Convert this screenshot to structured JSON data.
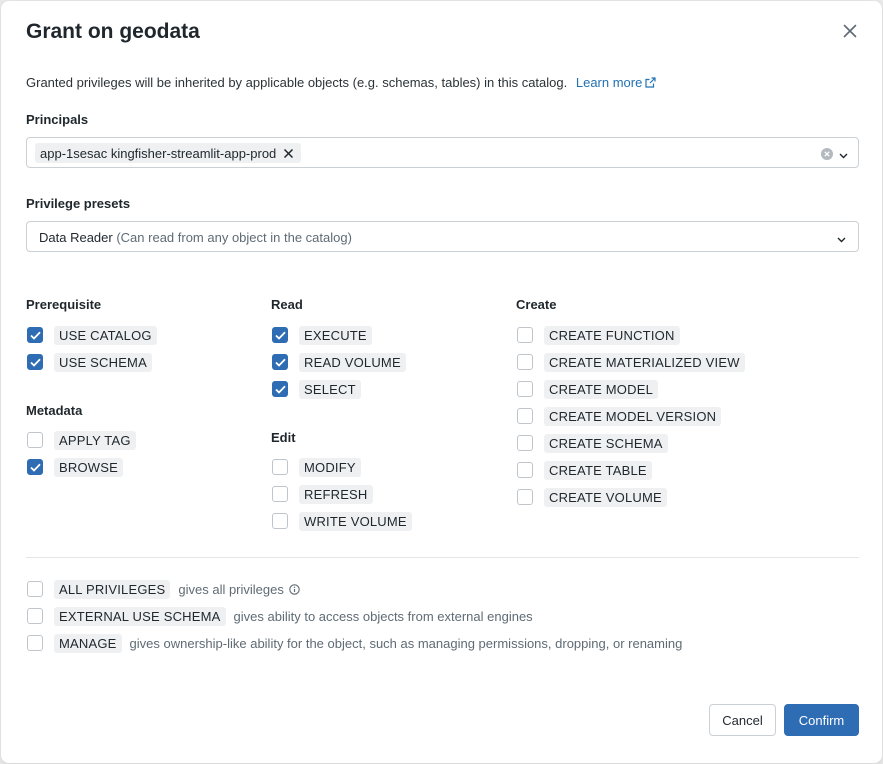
{
  "dialog": {
    "title": "Grant on geodata",
    "description": "Granted privileges will be inherited by applicable objects (e.g. schemas, tables) in this catalog.",
    "learn_more": "Learn more"
  },
  "principals": {
    "label": "Principals",
    "selected": "app-1sesac kingfisher-streamlit-app-prod"
  },
  "presets": {
    "label": "Privilege presets",
    "value": "Data Reader",
    "hint": "(Can read from any object in the catalog)"
  },
  "groups": {
    "prerequisite": {
      "heading": "Prerequisite",
      "items": [
        {
          "label": "USE CATALOG",
          "checked": true
        },
        {
          "label": "USE SCHEMA",
          "checked": true
        }
      ]
    },
    "metadata": {
      "heading": "Metadata",
      "items": [
        {
          "label": "APPLY TAG",
          "checked": false
        },
        {
          "label": "BROWSE",
          "checked": true
        }
      ]
    },
    "read": {
      "heading": "Read",
      "items": [
        {
          "label": "EXECUTE",
          "checked": true
        },
        {
          "label": "READ VOLUME",
          "checked": true
        },
        {
          "label": "SELECT",
          "checked": true
        }
      ]
    },
    "edit": {
      "heading": "Edit",
      "items": [
        {
          "label": "MODIFY",
          "checked": false
        },
        {
          "label": "REFRESH",
          "checked": false
        },
        {
          "label": "WRITE VOLUME",
          "checked": false
        }
      ]
    },
    "create": {
      "heading": "Create",
      "items": [
        {
          "label": "CREATE FUNCTION",
          "checked": false
        },
        {
          "label": "CREATE MATERIALIZED VIEW",
          "checked": false
        },
        {
          "label": "CREATE MODEL",
          "checked": false
        },
        {
          "label": "CREATE MODEL VERSION",
          "checked": false
        },
        {
          "label": "CREATE SCHEMA",
          "checked": false
        },
        {
          "label": "CREATE TABLE",
          "checked": false
        },
        {
          "label": "CREATE VOLUME",
          "checked": false
        }
      ]
    }
  },
  "special": {
    "all_privileges": {
      "label": "ALL PRIVILEGES",
      "desc": "gives all privileges",
      "checked": false
    },
    "external_use_schema": {
      "label": "EXTERNAL USE SCHEMA",
      "desc": "gives ability to access objects from external engines",
      "checked": false
    },
    "manage": {
      "label": "MANAGE",
      "desc": "gives ownership-like ability for the object, such as managing permissions, dropping, or renaming",
      "checked": false
    }
  },
  "footer": {
    "cancel": "Cancel",
    "confirm": "Confirm"
  },
  "colors": {
    "accent": "#2e6cb3",
    "link": "#2272b4",
    "chip_bg": "#eef0f2"
  },
  "icons": {
    "close": "close-icon",
    "external_link": "external-link-icon",
    "chip_remove": "x-icon",
    "clear": "clear-circle-icon",
    "dropdown": "chevron-down-icon",
    "checkbox_checked": "checkmark-icon",
    "info": "info-icon"
  }
}
